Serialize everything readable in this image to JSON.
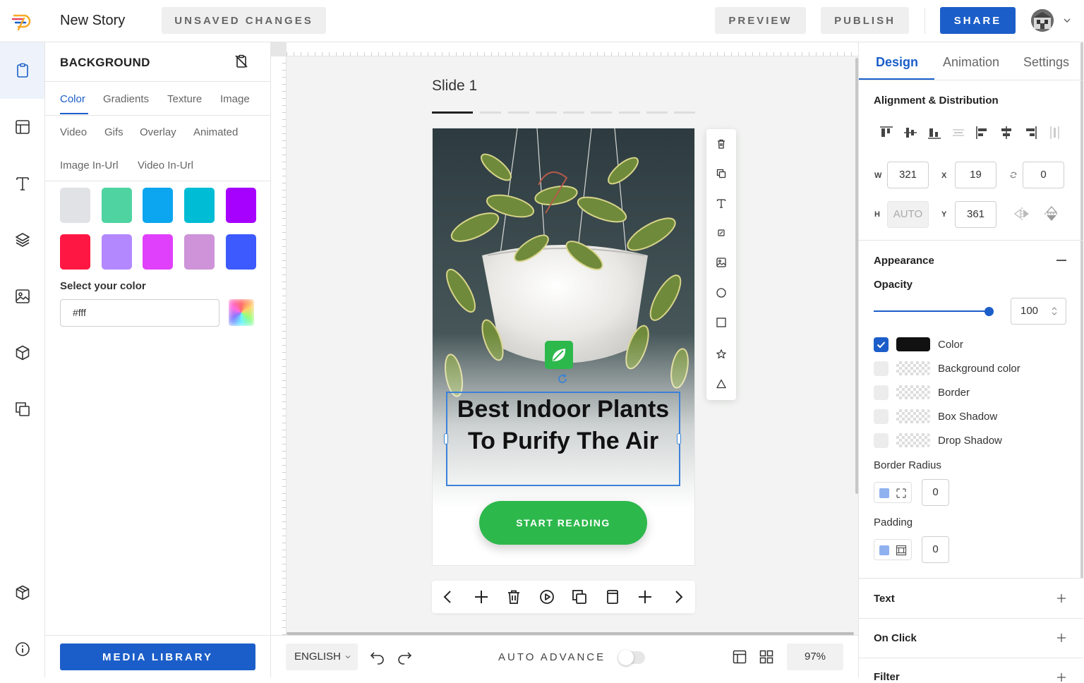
{
  "header": {
    "story_title": "New Story",
    "unsaved": "UNSAVED CHANGES",
    "preview": "PREVIEW",
    "publish": "PUBLISH",
    "share": "SHARE"
  },
  "left_panel": {
    "title": "BACKGROUND",
    "tabs_row1": [
      "Color",
      "Gradients",
      "Texture",
      "Image"
    ],
    "tabs_row2": [
      "Video",
      "Gifs",
      "Overlay",
      "Animated"
    ],
    "tabs_row3": [
      "Image In-Url",
      "Video In-Url"
    ],
    "active_tab": "Color",
    "swatches": [
      "#e1e2e5",
      "#4fd4a1",
      "#0ba6ef",
      "#00bcd4",
      "#a600ff",
      "#ff1744",
      "#b388ff",
      "#e040fb",
      "#ce93d8",
      "#3d5afe"
    ],
    "select_color_label": "Select your color",
    "hex_value": "#fff",
    "media_library": "MEDIA LIBRARY"
  },
  "canvas": {
    "slide_label": "Slide 1",
    "headline": "Best Indoor Plants To Purify The Air",
    "cta": "START READING",
    "accent": "#2db84c"
  },
  "bottom": {
    "language": "ENGLISH",
    "auto_advance": "AUTO ADVANCE",
    "zoom": "97%"
  },
  "right_panel": {
    "tabs": [
      "Design",
      "Animation",
      "Settings"
    ],
    "alignment_title": "Alignment & Distribution",
    "w_label": "W",
    "w": "321",
    "x_label": "X",
    "x": "19",
    "rot": "0",
    "h_label": "H",
    "h": "AUTO",
    "y_label": "Y",
    "y": "361",
    "appearance_title": "Appearance",
    "opacity_label": "Opacity",
    "opacity": "100",
    "props": [
      {
        "label": "Color",
        "checked": true
      },
      {
        "label": "Background color",
        "checked": false
      },
      {
        "label": "Border",
        "checked": false
      },
      {
        "label": "Box Shadow",
        "checked": false
      },
      {
        "label": "Drop Shadow",
        "checked": false
      }
    ],
    "border_radius_label": "Border Radius",
    "border_radius": "0",
    "padding_label": "Padding",
    "padding": "0",
    "text_section": "Text",
    "onclick_section": "On Click",
    "filter_section": "Filter"
  }
}
